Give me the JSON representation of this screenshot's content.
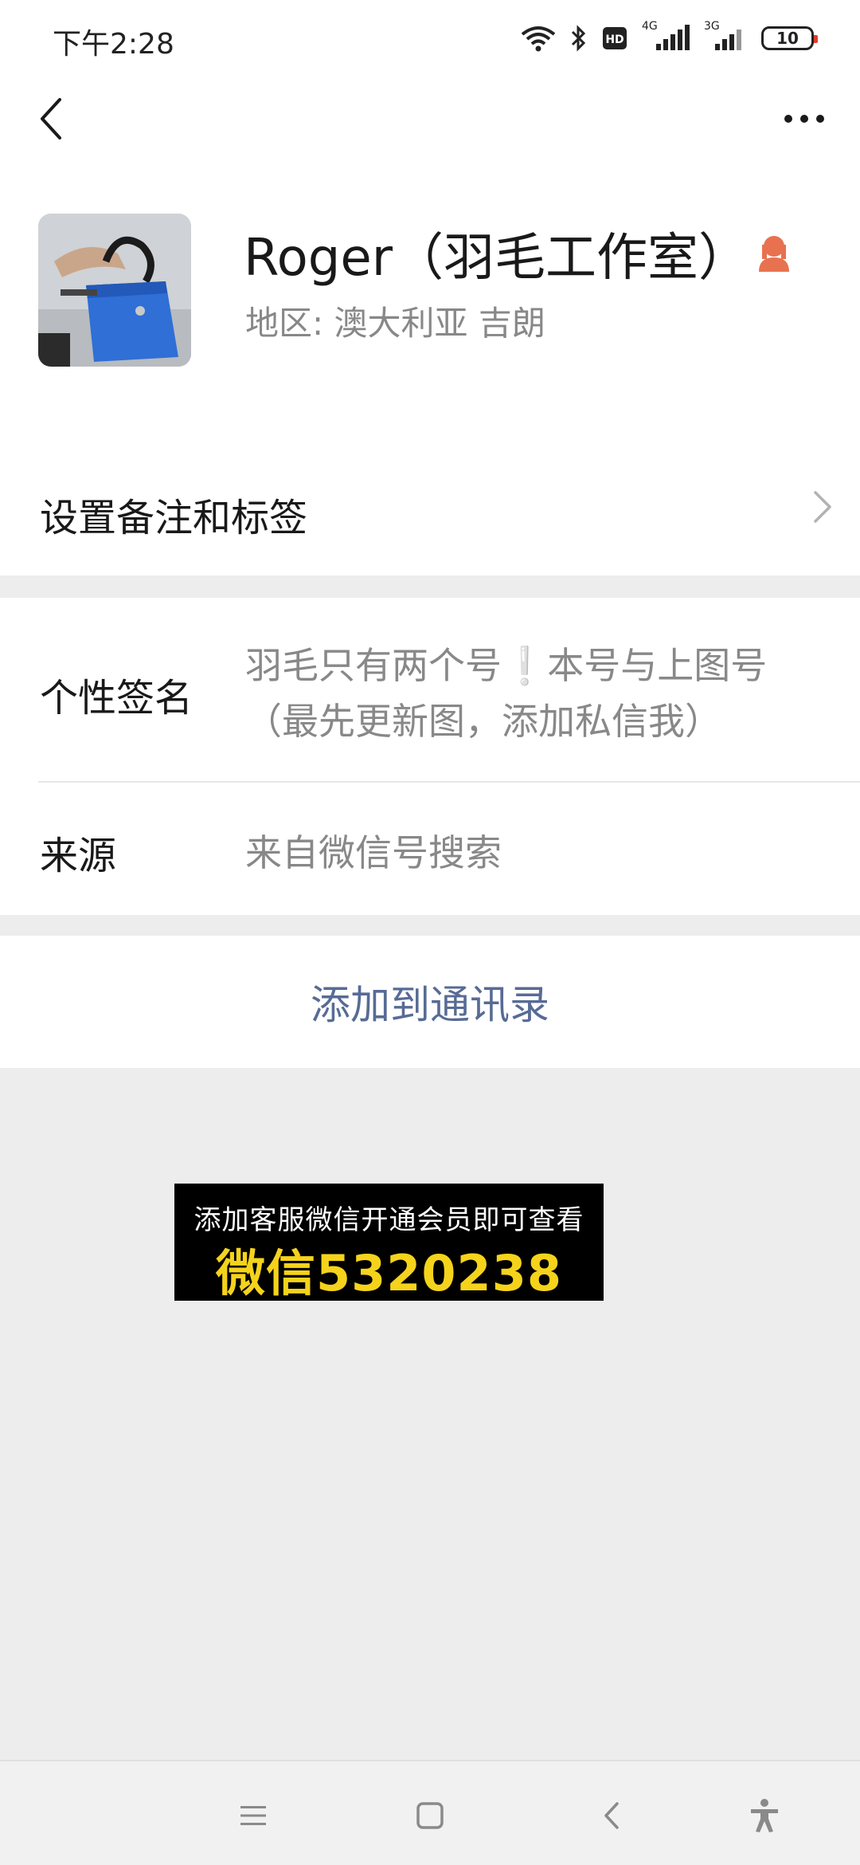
{
  "status_bar": {
    "time": "下午2:28",
    "network_1": "4G",
    "network_2": "3G",
    "battery": "10",
    "icons": [
      "wifi-icon",
      "bluetooth-icon",
      "hd-icon",
      "signal-icon",
      "signal-icon",
      "battery-icon"
    ]
  },
  "nav": {
    "back_icon": "chevron-left-icon",
    "more_icon": "more-dots-icon"
  },
  "profile": {
    "name": "Roger（羽毛工作室）",
    "region": "地区:  澳大利亚  吉朗",
    "gender_icon": "female-icon"
  },
  "remark": {
    "label": "设置备注和标签"
  },
  "signature": {
    "label": "个性签名",
    "value": "羽毛只有两个号❕本号与上图号（最先更新图，添加私信我）"
  },
  "source": {
    "label": "来源",
    "value": "来自微信号搜索"
  },
  "add_contact": {
    "label": "添加到通讯录"
  },
  "promo": {
    "line1": "添加客服微信开通会员即可查看",
    "line2": "微信5320238"
  },
  "system_nav": {
    "icons": [
      "menu-icon",
      "home-square-icon",
      "back-icon",
      "accessibility-icon"
    ]
  },
  "colors": {
    "link": "#576b95",
    "secondary_text": "#888888",
    "background": "#ededed",
    "promo_yellow": "#f5d31b",
    "gender": "#e8724f"
  }
}
